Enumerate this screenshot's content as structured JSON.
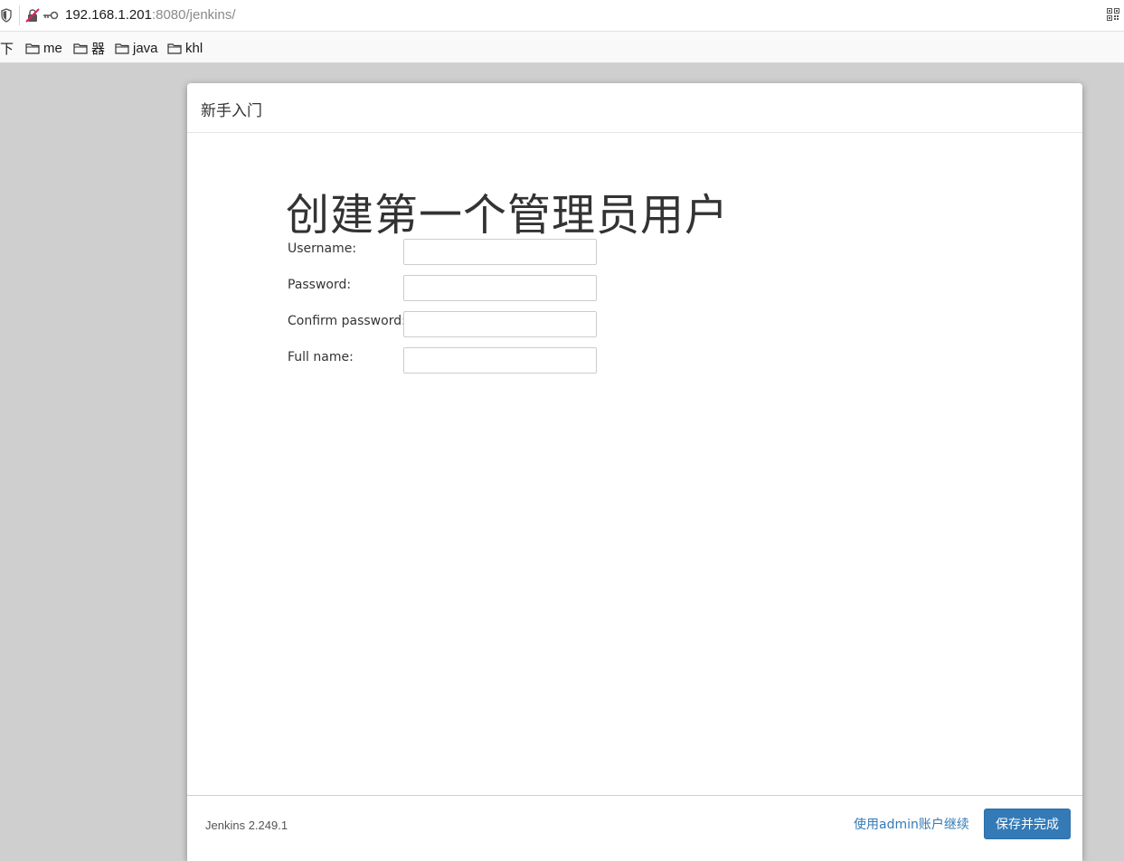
{
  "browser": {
    "url_host": "192.168.1.201",
    "url_path": ":8080/jenkins/",
    "bookmarks": [
      {
        "label": "下",
        "icon": "none"
      },
      {
        "label": "me",
        "icon": "folder-icon"
      },
      {
        "label": "器",
        "icon": "folder-icon"
      },
      {
        "label": "java",
        "icon": "folder-icon"
      },
      {
        "label": "khl",
        "icon": "folder-icon"
      }
    ]
  },
  "dialog": {
    "title": "新手入门",
    "heading": "创建第一个管理员用户",
    "fields": [
      {
        "label": "Username:",
        "value": "",
        "type": "text"
      },
      {
        "label": "Password:",
        "value": "",
        "type": "password"
      },
      {
        "label": "Confirm password:",
        "value": "",
        "type": "password"
      },
      {
        "label": "Full name:",
        "value": "",
        "type": "text"
      }
    ],
    "footer": {
      "version": "Jenkins 2.249.1",
      "admin_link": "使用admin账户继续",
      "save_button": "保存并完成"
    }
  },
  "colors": {
    "primary": "#337ab7",
    "page_background": "#cfcfcf"
  }
}
